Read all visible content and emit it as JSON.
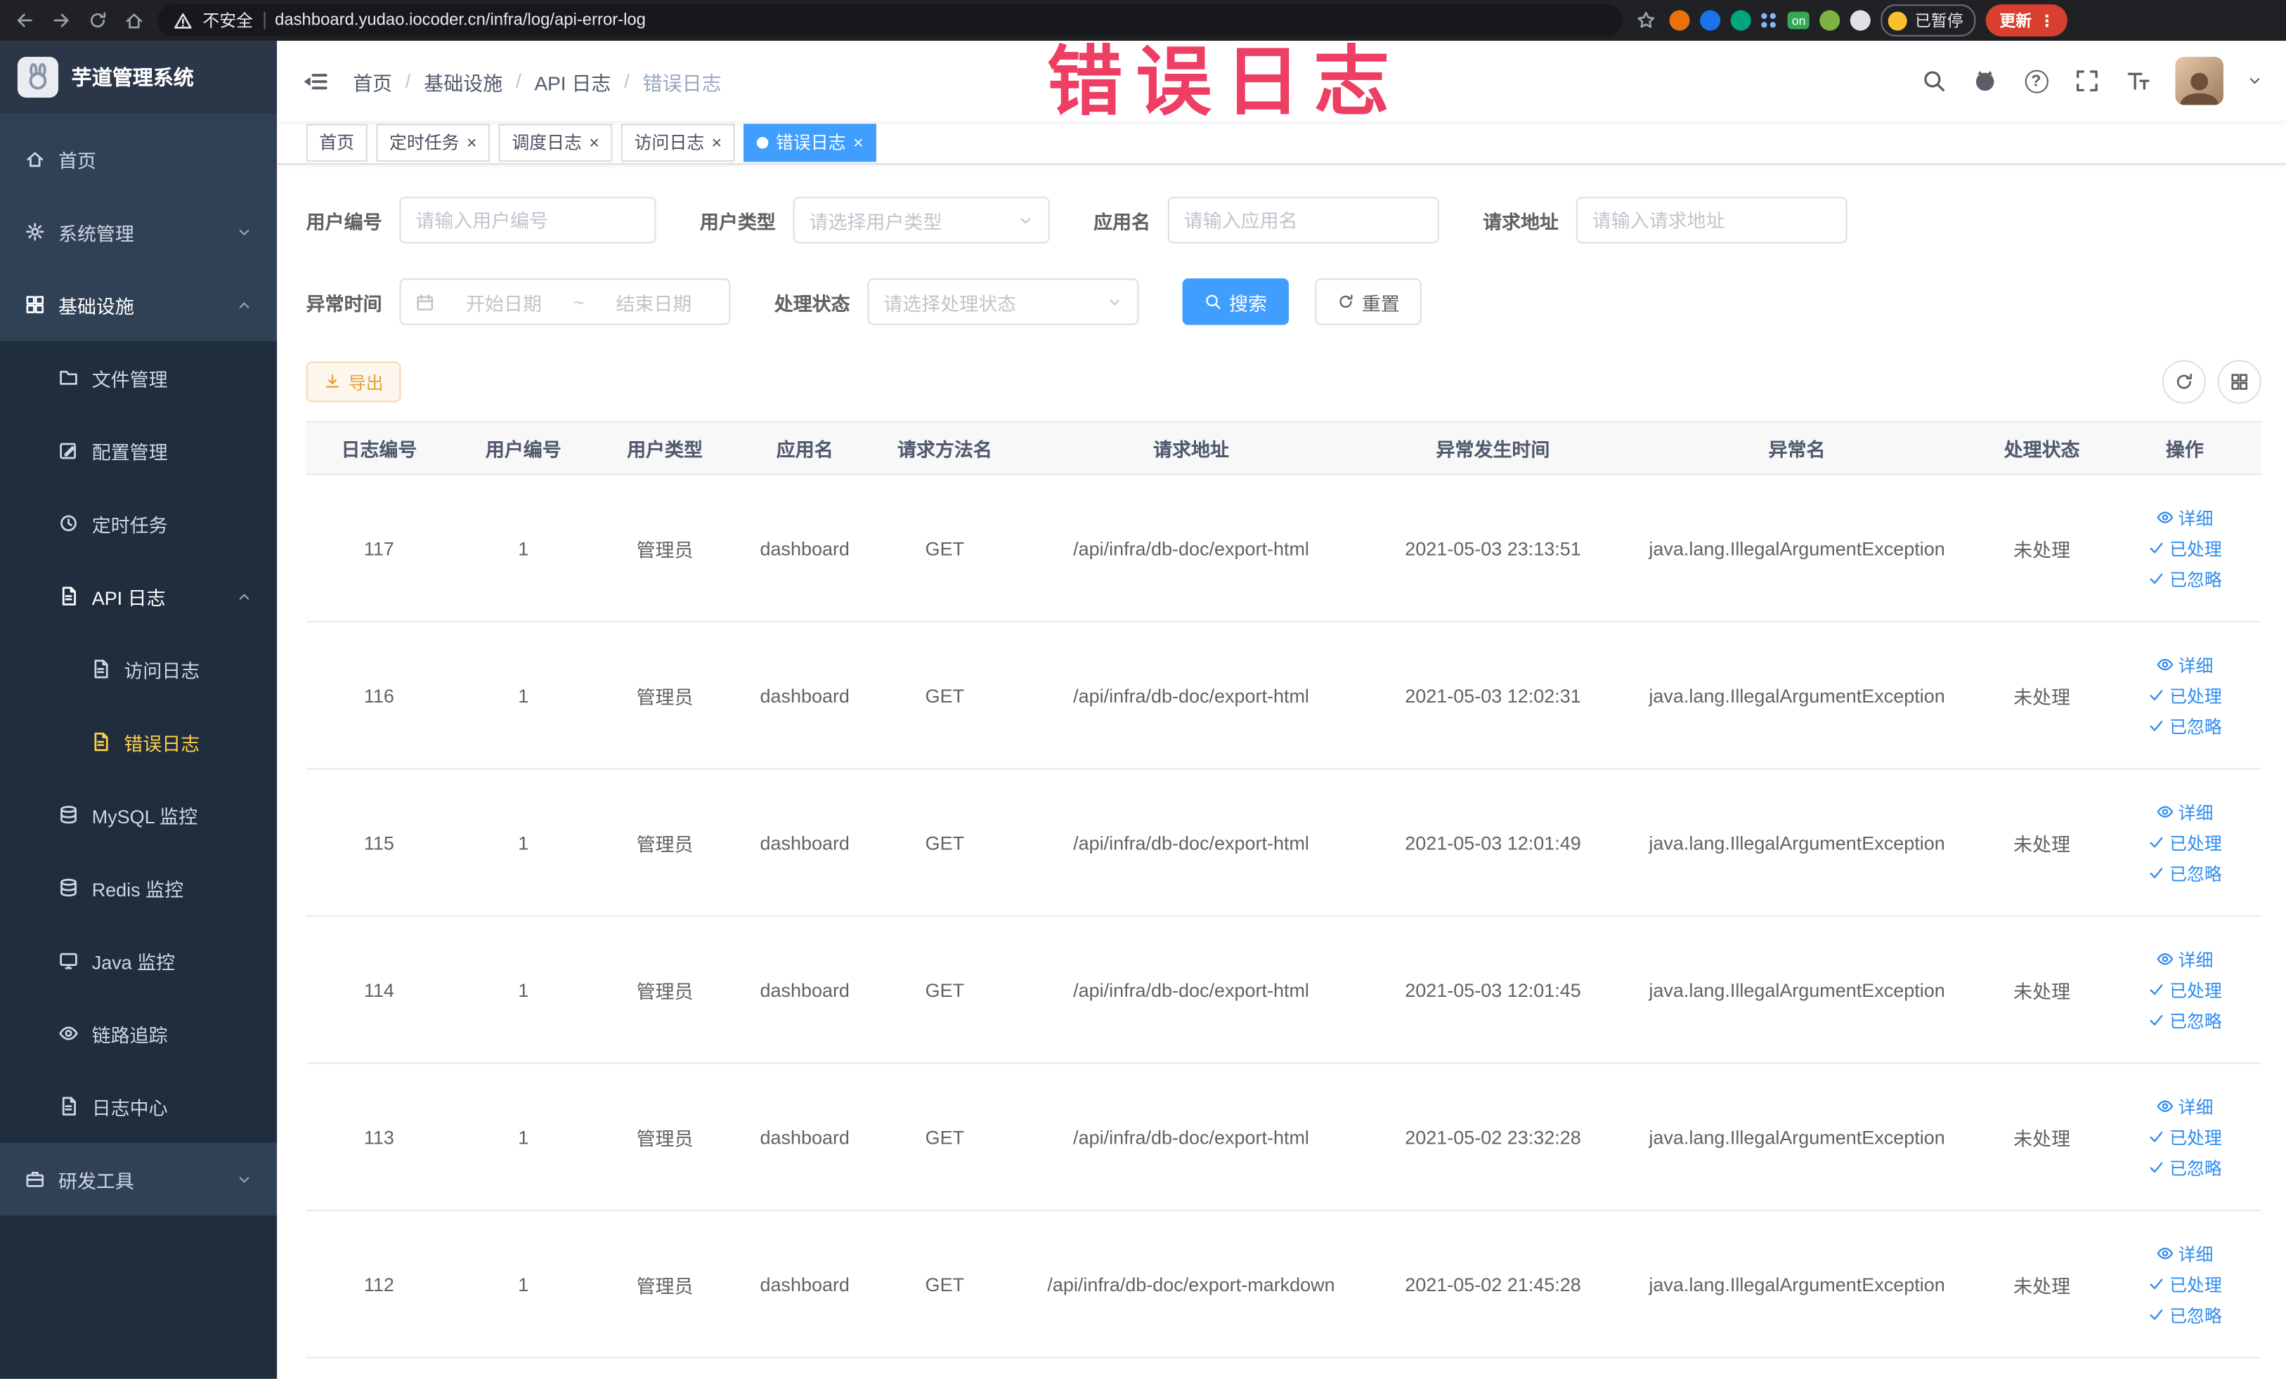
{
  "colors": {
    "accent": "#409eff",
    "menu_active": "#ffd04b",
    "link_blue": "#2d8cf0",
    "warning": "#e6a23c",
    "overlay_pink": "#ee3e63",
    "update_chip": "#d93f2e",
    "sidebar_bg": "#304156",
    "submenu_bg": "#1f2d3d"
  },
  "icons": {
    "close": "×",
    "kebab": "⋮",
    "question": "?"
  },
  "browser": {
    "security_label": "不安全",
    "url": "dashboard.yudao.iocoder.cn/infra/log/api-error-log",
    "extension_badge": "on",
    "paused_badge": "已暂停",
    "update_label": "更新"
  },
  "overlay_text": "错误日志",
  "app": {
    "title": "芋道管理系统"
  },
  "sidebar": {
    "home": "首页",
    "system": "系统管理",
    "infra": "基础设施",
    "file": "文件管理",
    "config": "配置管理",
    "job": "定时任务",
    "api_log": "API 日志",
    "access_log": "访问日志",
    "error_log": "错误日志",
    "mysql": "MySQL 监控",
    "redis": "Redis 监控",
    "java": "Java 监控",
    "trace": "链路追踪",
    "log_center": "日志中心",
    "devtools": "研发工具"
  },
  "breadcrumb": [
    "首页",
    "基础设施",
    "API 日志",
    "错误日志"
  ],
  "tabs": [
    {
      "label": "首页"
    },
    {
      "label": "定时任务"
    },
    {
      "label": "调度日志"
    },
    {
      "label": "访问日志"
    },
    {
      "label": "错误日志"
    }
  ],
  "filters": {
    "user_id_label": "用户编号",
    "user_id_placeholder": "请输入用户编号",
    "user_type_label": "用户类型",
    "user_type_placeholder": "请选择用户类型",
    "app_name_label": "应用名",
    "app_name_placeholder": "请输入应用名",
    "request_url_label": "请求地址",
    "request_url_placeholder": "请输入请求地址",
    "time_label": "异常时间",
    "time_start_placeholder": "开始日期",
    "time_separator": "~",
    "time_end_placeholder": "结束日期",
    "status_label": "处理状态",
    "status_placeholder": "请选择处理状态",
    "search_button": "搜索",
    "reset_button": "重置"
  },
  "toolbar": {
    "export_button": "导出"
  },
  "table": {
    "headers": [
      "日志编号",
      "用户编号",
      "用户类型",
      "应用名",
      "请求方法名",
      "请求地址",
      "异常发生时间",
      "异常名",
      "处理状态",
      "操作"
    ],
    "actions": {
      "detail": "详细",
      "processed": "已处理",
      "ignored": "已忽略"
    },
    "rows": [
      {
        "id": "117",
        "user_id": "1",
        "user_type": "管理员",
        "app_name": "dashboard",
        "method": "GET",
        "url": "/api/infra/db-doc/export-html",
        "time": "2021-05-03 23:13:51",
        "exception": "java.lang.IllegalArgumentException",
        "status": "未处理"
      },
      {
        "id": "116",
        "user_id": "1",
        "user_type": "管理员",
        "app_name": "dashboard",
        "method": "GET",
        "url": "/api/infra/db-doc/export-html",
        "time": "2021-05-03 12:02:31",
        "exception": "java.lang.IllegalArgumentException",
        "status": "未处理"
      },
      {
        "id": "115",
        "user_id": "1",
        "user_type": "管理员",
        "app_name": "dashboard",
        "method": "GET",
        "url": "/api/infra/db-doc/export-html",
        "time": "2021-05-03 12:01:49",
        "exception": "java.lang.IllegalArgumentException",
        "status": "未处理"
      },
      {
        "id": "114",
        "user_id": "1",
        "user_type": "管理员",
        "app_name": "dashboard",
        "method": "GET",
        "url": "/api/infra/db-doc/export-html",
        "time": "2021-05-03 12:01:45",
        "exception": "java.lang.IllegalArgumentException",
        "status": "未处理"
      },
      {
        "id": "113",
        "user_id": "1",
        "user_type": "管理员",
        "app_name": "dashboard",
        "method": "GET",
        "url": "/api/infra/db-doc/export-html",
        "time": "2021-05-02 23:32:28",
        "exception": "java.lang.IllegalArgumentException",
        "status": "未处理"
      },
      {
        "id": "112",
        "user_id": "1",
        "user_type": "管理员",
        "app_name": "dashboard",
        "method": "GET",
        "url": "/api/infra/db-doc/export-markdown",
        "time": "2021-05-02 21:45:28",
        "exception": "java.lang.IllegalArgumentException",
        "status": "未处理"
      }
    ]
  }
}
